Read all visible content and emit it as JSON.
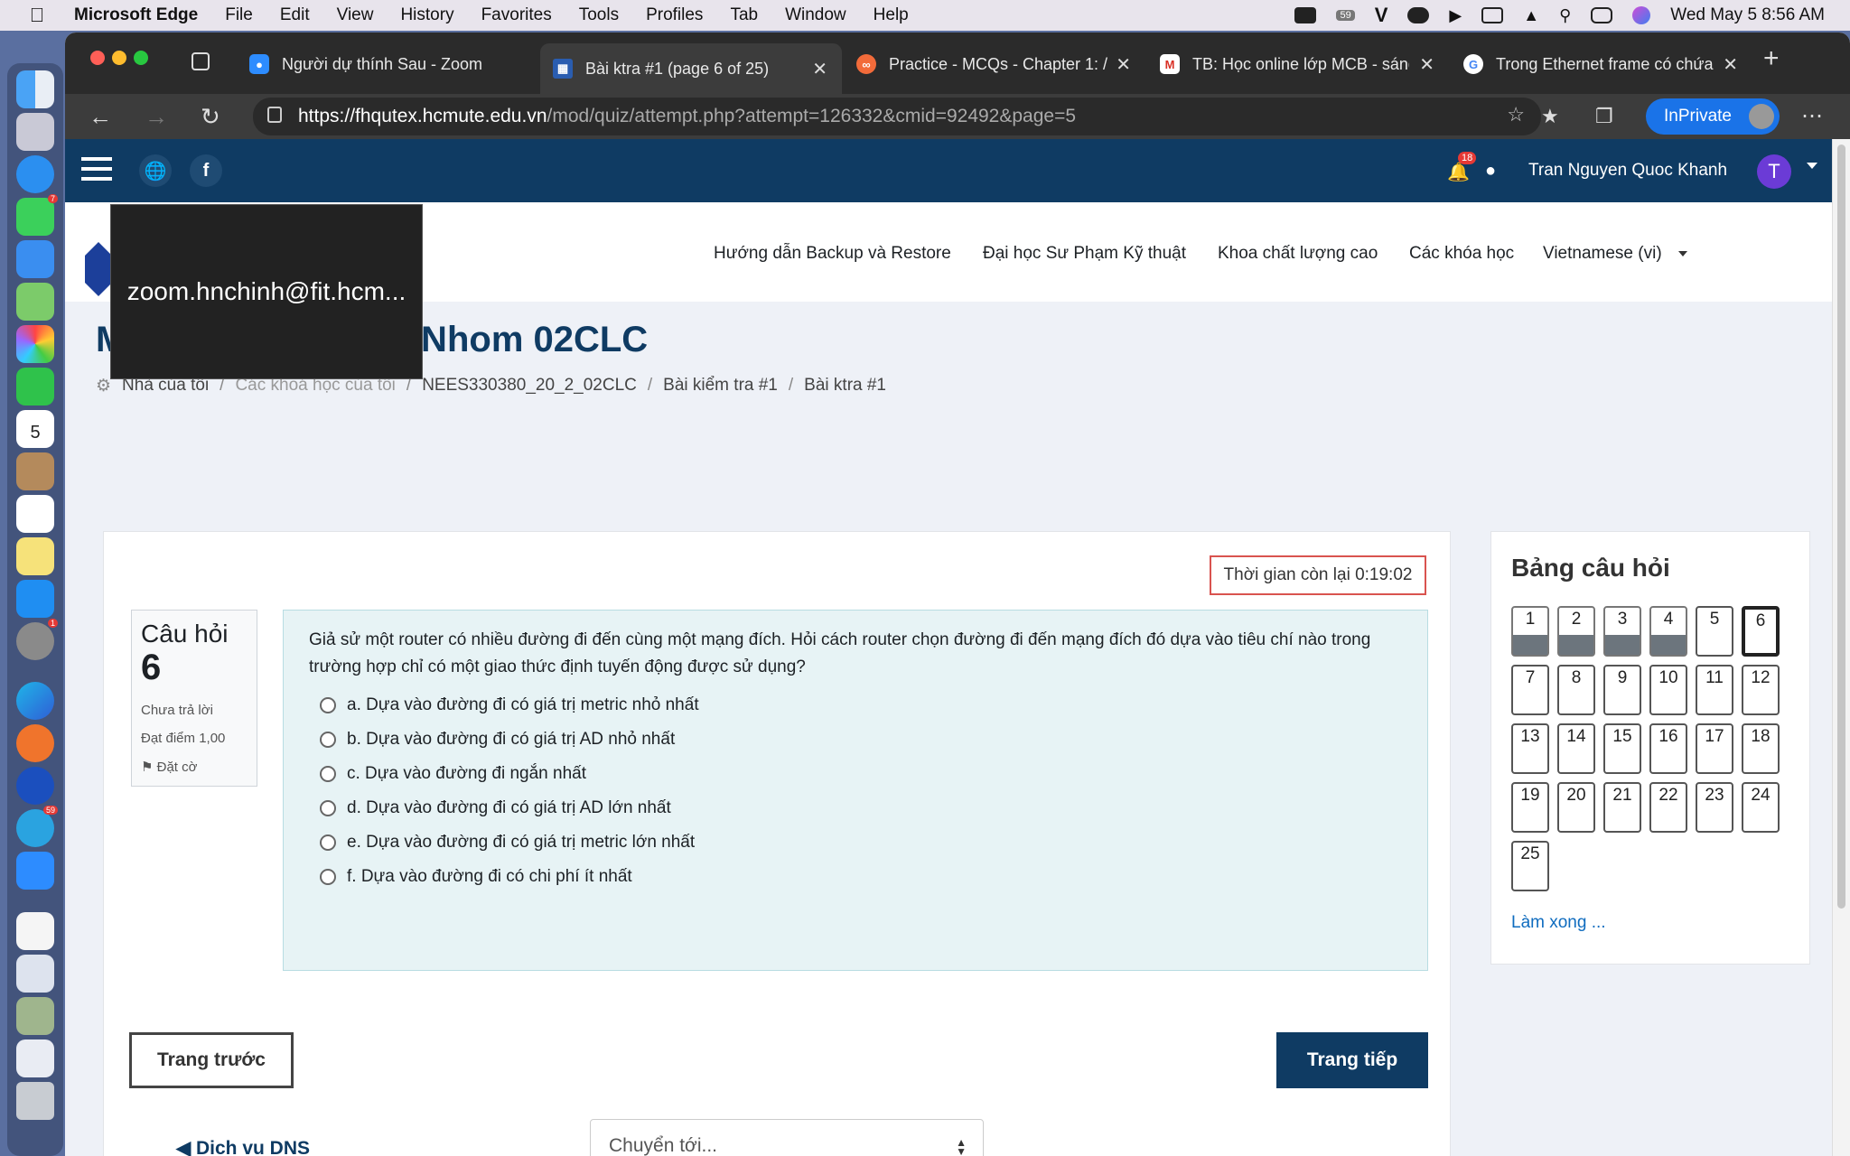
{
  "menubar": {
    "app": "Microsoft Edge",
    "items": [
      "File",
      "Edit",
      "View",
      "History",
      "Favorites",
      "Tools",
      "Profiles",
      "Tab",
      "Window",
      "Help"
    ],
    "clock": "Wed May 5  8:56 AM",
    "battery_badge": "59"
  },
  "tabs": [
    {
      "title": "Người dự thính Sau - Zoom",
      "icon": "zoom-icon",
      "color": "#2d8cff"
    },
    {
      "title": "Bài ktra #1 (page 6 of 25)",
      "icon": "moodle-icon",
      "color": "#2a5db0"
    },
    {
      "title": "Practice - MCQs - Chapter 1: /",
      "icon": "practice-icon",
      "color": "#f26b3a"
    },
    {
      "title": "TB: Học online lớp MCB - sáng",
      "icon": "gmail-icon",
      "color": "#d93025"
    },
    {
      "title": "Trong Ethernet frame có chứa",
      "icon": "google-icon",
      "color": "#ffffff"
    }
  ],
  "address": {
    "host": "https://fhqutex.hcmute.edu.vn",
    "path": "/mod/quiz/attempt.php?attempt=126332&cmid=92492&page=5",
    "inprivate": "InPrivate"
  },
  "topnav": {
    "user": "Tran Nguyen Quoc Khanh",
    "avatar_letter": "T",
    "notifications": "18"
  },
  "sitenav": [
    "Hướng dẫn Backup và Restore",
    "Đại học Sư Phạm Kỹ thuật",
    "Khoa chất lượng cao",
    "Các khóa học",
    "Vietnamese (vi)"
  ],
  "zoom_overlay": "zoom.hnchinh@fit.hcm...",
  "course_title": "M                    ban_ Nhom 02CLC",
  "breadcrumb": [
    "Nhà của tôi",
    "Các khoá học của tôi",
    "NEES330380_20_2_02CLC",
    "Bài kiểm tra #1",
    "Bài ktra #1"
  ],
  "quiz": {
    "timer": "Thời gian còn lại 0:19:02",
    "q_label": "Câu hỏi",
    "q_number": "6",
    "status": "Chưa trả lời",
    "points": "Đạt điểm 1,00",
    "flag": "Đặt cờ",
    "question": "Giả sử một router có nhiều đường đi đến cùng một mạng đích. Hỏi cách router chọn đường đi đến mạng đích đó dựa vào tiêu chí nào trong trường hợp chỉ có một giao thức định tuyến động được sử dụng?",
    "options": [
      "a. Dựa vào đường đi có giá trị metric nhỏ nhất",
      "b. Dựa vào đường đi có giá trị AD nhỏ nhất",
      "c. Dựa vào đường đi ngắn nhất",
      "d. Dựa vào đường đi có giá trị AD lớn nhất",
      "e. Dựa vào đường đi có giá trị metric lớn nhất",
      "f. Dựa vào đường đi có chi phí ít nhất"
    ],
    "prev": "Trang trước",
    "next": "Trang tiếp",
    "prev_activity": "◀ Dich vu DNS",
    "jump": "Chuyển tới..."
  },
  "nav": {
    "title": "Bảng câu hỏi",
    "questions": [
      "1",
      "2",
      "3",
      "4",
      "5",
      "6",
      "7",
      "8",
      "9",
      "10",
      "11",
      "12",
      "13",
      "14",
      "15",
      "16",
      "17",
      "18",
      "19",
      "20",
      "21",
      "22",
      "23",
      "24",
      "25"
    ],
    "answered": [
      1,
      2,
      3,
      4
    ],
    "current": 6,
    "finish": "Làm xong ..."
  }
}
